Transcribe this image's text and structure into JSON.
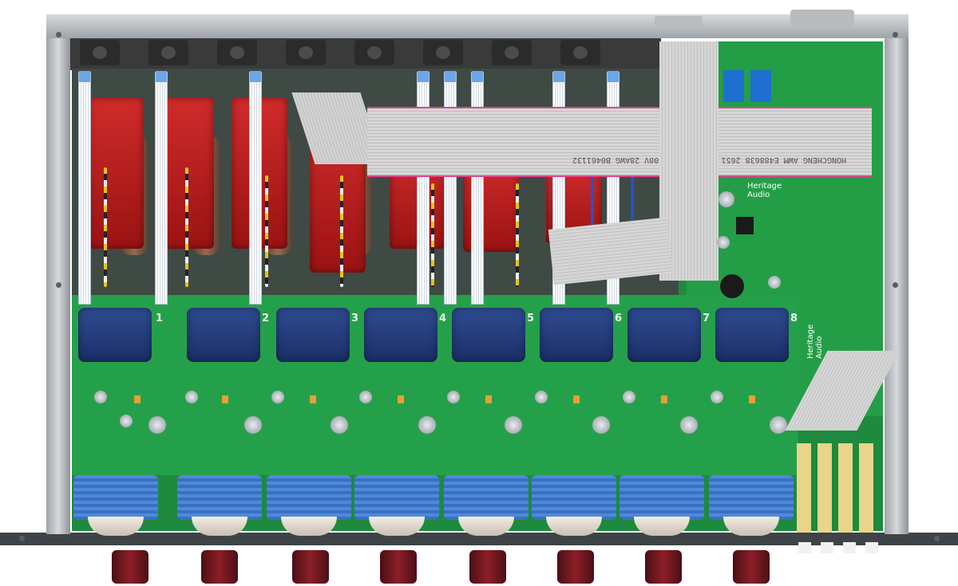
{
  "image": {
    "subject": "Top-down view inside an open 8-channel rack unit",
    "colors": {
      "pcb_green": "#229a45",
      "chassis_metal": "#b4b9bd",
      "transformer_red": "#b11c1c",
      "transformer_blue": "#223a78",
      "ribbon_grey": "#c9c9c9",
      "knob_red": "#6e1a20",
      "collar_blue": "#4a86d6"
    }
  },
  "channel_numbers": [
    "1",
    "2",
    "3",
    "4",
    "5",
    "6",
    "7",
    "8"
  ],
  "logos": {
    "top": "Heritage Audio",
    "side": "Heritage Audio"
  },
  "ribbon_cable_text": "HONGCHENG  AWM  E488638  2651  VW-1  105°C  300V  28AWG  B0461132"
}
